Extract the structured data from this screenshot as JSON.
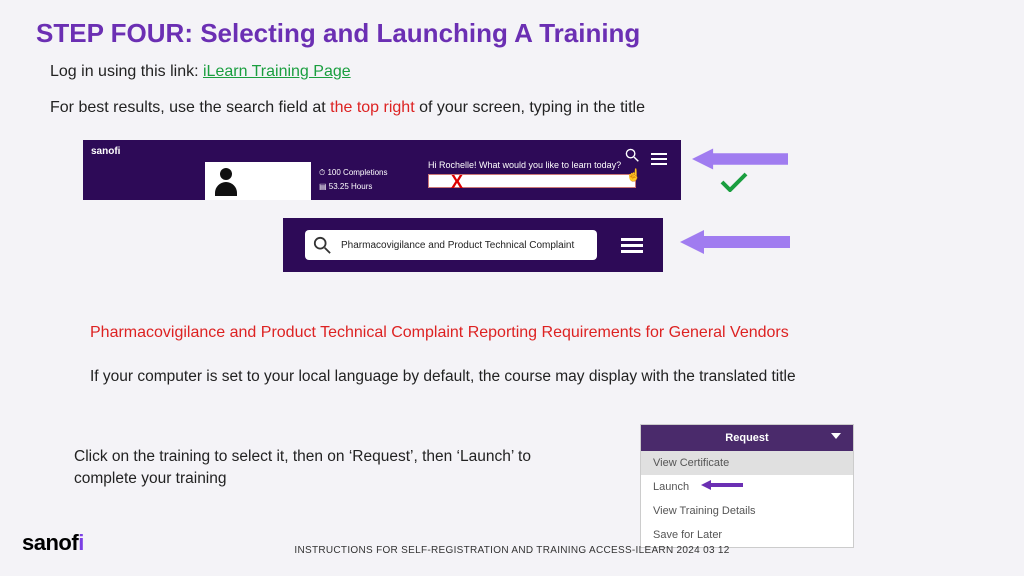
{
  "title": "STEP FOUR: Selecting and Launching A Training",
  "line1_a": "Log in using this link: ",
  "line1_link": "iLearn Training Page",
  "line2_a": "For best results, use the search field at ",
  "line2_red": "the top right",
  "line2_b": " of your screen, typing in the title",
  "banner1": {
    "brand": "sanofi",
    "stat1": "100 Completions",
    "stat2": "53.25 Hours",
    "greet": "Hi Rochelle! What would you like to learn today?",
    "x": "X"
  },
  "banner2": {
    "search_text": "Pharmacovigilance and Product Technical Complaint"
  },
  "redline": "Pharmacovigilance and Product Technical Complaint Reporting Requirements for General Vendors",
  "localnote": "If your computer is set to your local language by default, the course may display with the translated title",
  "clicknote": "Click on the training to select it, then on ‘Request’, then ‘Launch’ to complete your training",
  "dropdown": {
    "request": "Request",
    "opt1": "View Certificate",
    "opt2": "Launch",
    "opt3": "View Training Details",
    "opt4": "Save for Later"
  },
  "logo_a": "sanof",
  "logo_dot": "i",
  "footer": "INSTRUCTIONS FOR SELF-REGISTRATION AND TRAINING ACCESS-ILEARN 2024 03 12",
  "colors": {
    "accent": "#a07cf0",
    "check": "#1a9e3f",
    "miniArrow": "#6b2fb3"
  }
}
